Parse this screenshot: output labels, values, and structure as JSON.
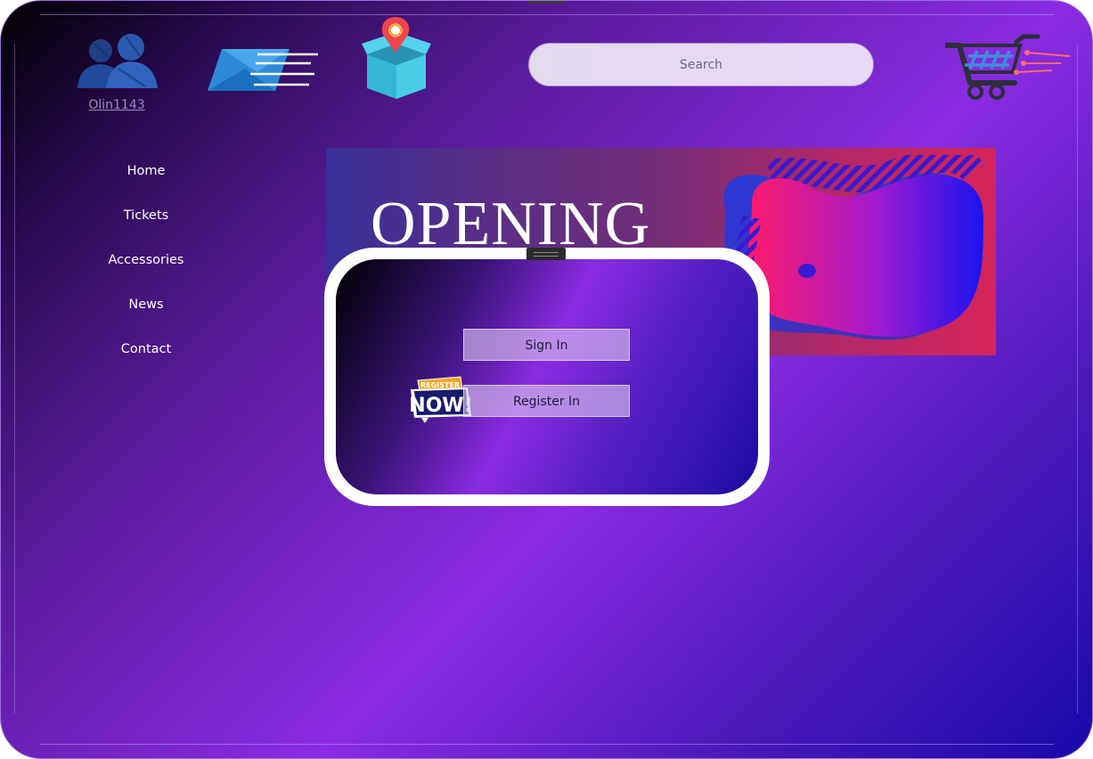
{
  "user": {
    "name": "Olin1143",
    "icon": "users-icon"
  },
  "header": {
    "mail_icon": "mail-icon",
    "box_icon": "package-location-icon",
    "cart_icon": "shopping-cart-icon",
    "search": {
      "placeholder": "Search"
    }
  },
  "nav": {
    "items": [
      "Home",
      "Tickets",
      "Accessories",
      "News",
      "Contact"
    ]
  },
  "banner": {
    "title": "OPENING"
  },
  "modal": {
    "sign_in": "Sign In",
    "register": "Register In",
    "badge_small": "REGISTER",
    "badge_big": "NOW!"
  },
  "colors": {
    "accent": "#8a2be2",
    "deep_blue": "#1808a8",
    "banner_pink": "#d4245a"
  }
}
